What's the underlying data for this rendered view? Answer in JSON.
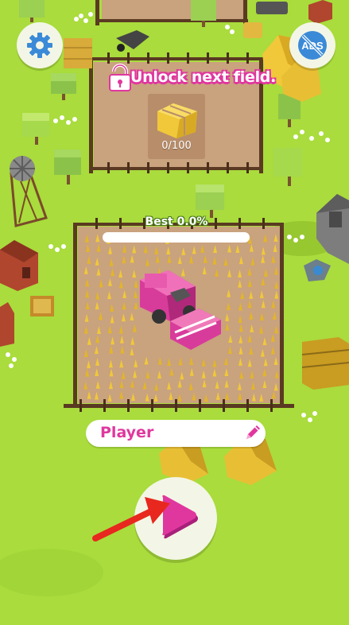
{
  "hud": {
    "settings_icon": "gear-icon",
    "noads_label": "ADS",
    "noads_icon": "no-ads-icon"
  },
  "unlock_panel": {
    "title": "Unlock next field.",
    "progress": "0/100",
    "lock_icon": "lock-icon",
    "item_icon": "hay-bale-icon"
  },
  "field": {
    "best_label": "Best 0.0%",
    "best_percent": 0.0
  },
  "player": {
    "name": "Player",
    "edit_icon": "pencil-icon"
  },
  "play": {
    "play_icon": "play-icon",
    "hint_icon": "red-arrow-icon"
  },
  "colors": {
    "grass": "#a9dc3c",
    "accent_pink": "#e0379e",
    "button_bg": "#f3f6e6",
    "dirt": "#c9a27e",
    "fence": "#5a3a22",
    "wheat": "#f0c83a",
    "harvester": "#d83c9b",
    "arrow_red": "#e8271f"
  }
}
